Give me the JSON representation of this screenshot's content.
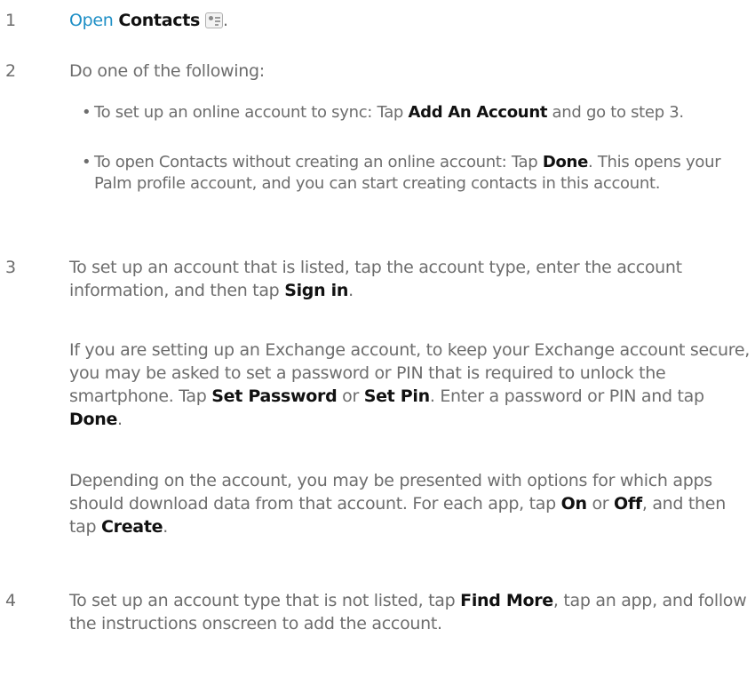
{
  "steps": [
    {
      "number": "1",
      "open_word": "Open",
      "app_name": "Contacts",
      "icon": "contacts-app-icon",
      "trailing": "."
    },
    {
      "number": "2",
      "text": "Do one of the following:",
      "bullets": [
        {
          "before": "To set up an online account to sync: Tap ",
          "bold": "Add An Account",
          "after": " and go to step 3."
        },
        {
          "before": "To open Contacts without creating an online account: Tap ",
          "bold": "Done",
          "after": ". This opens your Palm profile account, and you can start creating contacts in this account."
        }
      ]
    },
    {
      "number": "3",
      "para1": {
        "before": "To set up an account that is listed, tap the account type, enter the account information, and then tap ",
        "bold": "Sign in",
        "after": "."
      },
      "para2": {
        "t1": "If you are setting up an Exchange account, to keep your Exchange account secure, you may be asked to set a password or PIN that is required to unlock the smartphone. Tap ",
        "b1": "Set Password",
        "t2": " or ",
        "b2": "Set Pin",
        "t3": ". Enter a password or PIN and tap ",
        "b3": "Done",
        "t4": "."
      },
      "para3": {
        "t1": "Depending on the account, you may be presented with options for which apps should download data from that account. For each app, tap ",
        "b1": "On",
        "t2": " or ",
        "b2": "Off",
        "t3": ", and then tap ",
        "b3": "Create",
        "t4": "."
      }
    },
    {
      "number": "4",
      "before": "To set up an account type that is not listed, tap ",
      "bold": "Find More",
      "after": ", tap an app, and follow the instructions onscreen to add the account."
    }
  ]
}
